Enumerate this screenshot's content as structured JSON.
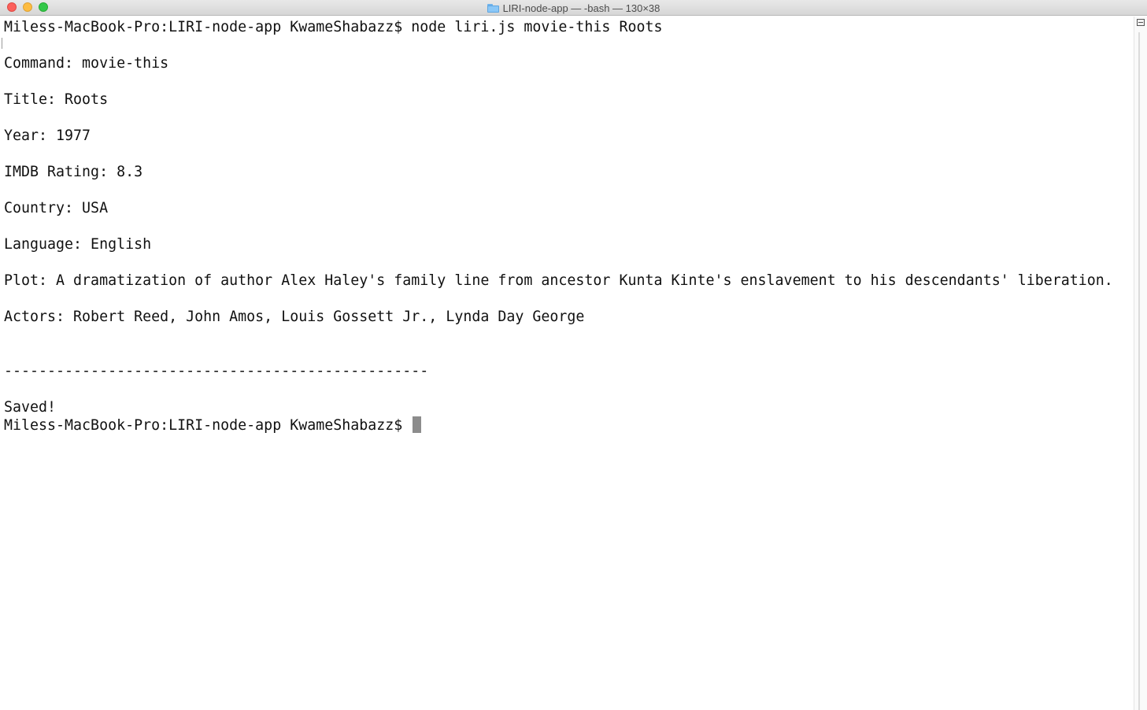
{
  "window": {
    "title": "LIRI-node-app — -bash — 130×38"
  },
  "terminal": {
    "lines": [
      "Miless-MacBook-Pro:LIRI-node-app KwameShabazz$ node liri.js movie-this Roots",
      "",
      "Command: movie-this",
      "",
      "Title: Roots",
      "",
      "Year: 1977",
      "",
      "IMDB Rating: 8.3",
      "",
      "Country: USA",
      "",
      "Language: English",
      "",
      "Plot: A dramatization of author Alex Haley's family line from ancestor Kunta Kinte's enslavement to his descendants' liberation.",
      "",
      "Actors: Robert Reed, John Amos, Louis Gossett Jr., Lynda Day George",
      "",
      "",
      "-------------------------------------------------",
      "",
      "Saved!"
    ],
    "prompt": "Miless-MacBook-Pro:LIRI-node-app KwameShabazz$ "
  }
}
